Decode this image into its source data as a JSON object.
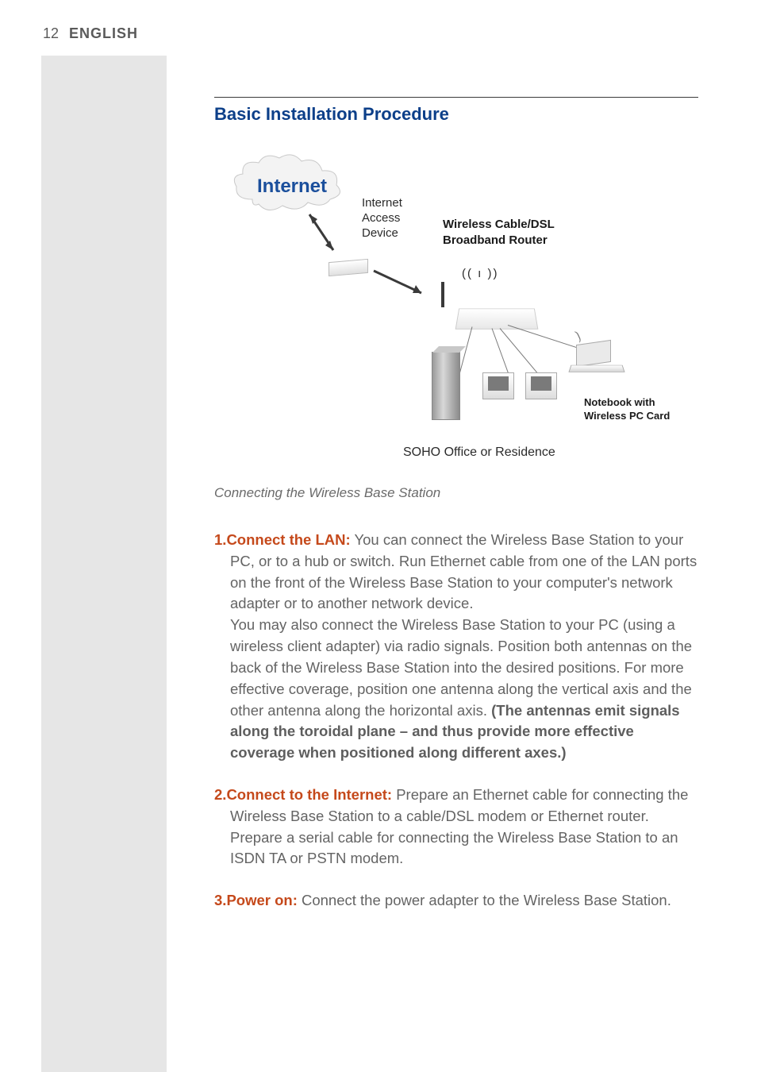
{
  "header": {
    "page_number": "12",
    "language": "ENGLISH"
  },
  "section": {
    "title": "Basic Installation Procedure"
  },
  "diagram": {
    "cloud_label": "Internet",
    "iad_label_l1": "Internet",
    "iad_label_l2": "Access",
    "iad_label_l3": "Device",
    "router_label_l1": "Wireless Cable/DSL",
    "router_label_l2": "Broadband Router",
    "antenna_glyph": "(( ı ))",
    "notebook_label_l1": "Notebook with",
    "notebook_label_l2": "Wireless PC Card",
    "soho_label": "SOHO Office or Residence"
  },
  "caption": "Connecting the Wireless Base Station",
  "steps": [
    {
      "num": "1.",
      "title": "Connect the LAN:",
      "body_a": " You can connect the Wireless Base Station to your PC, or to a hub or switch. Run Ethernet cable from one of the LAN ports on the front of the Wireless Base Station to your computer's network adapter or to another network device.",
      "body_b": "You may also connect the Wireless Base Station to your PC (using a wireless client adapter) via radio signals. Position both antennas on the back of the Wireless Base Station into the desired positions. For more effective coverage, position one antenna along the vertical axis and the other antenna along the horizontal axis. ",
      "bold": "(The antennas emit signals along the toroidal plane – and thus provide more effective coverage when positioned along different axes.)"
    },
    {
      "num": "2.",
      "title": "Connect to the Internet:",
      "body_a": " Prepare an Ethernet cable for connecting the Wireless Base Station to a cable/DSL modem or Ethernet router. Prepare a serial cable for connecting the Wireless Base Station to an ISDN TA or PSTN modem.",
      "body_b": "",
      "bold": ""
    },
    {
      "num": "3.",
      "title": "Power on:",
      "body_a": " Connect the power adapter to the Wireless Base Station.",
      "body_b": "",
      "bold": ""
    }
  ]
}
